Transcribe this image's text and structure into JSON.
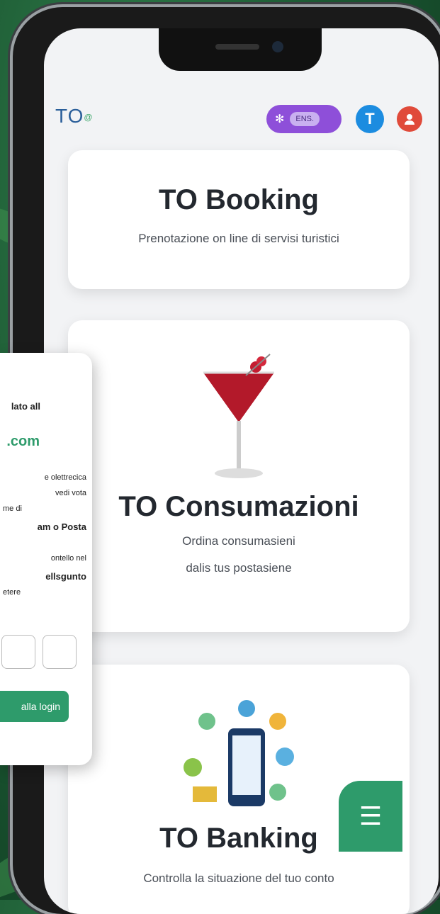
{
  "header": {
    "logo_text": "TO",
    "logo_suffix": "@",
    "pill_label": "ENS.",
    "pill_icon": "gear-sparkle-icon",
    "avatar_initial": "T",
    "user_icon": "user-icon"
  },
  "cards": [
    {
      "title": "TO Booking",
      "desc": "Prenotazione on line di servisi turistici"
    },
    {
      "title": "TO Consumazioni",
      "desc_line1": "Ordina consumasieni",
      "desc_line2": "dalis tus postasiene"
    },
    {
      "title": "TO Banking",
      "desc": "Controlla la situazione del tuo conto"
    }
  ],
  "modal": {
    "line1": "lato all",
    "email": ".com",
    "line2": "e olettrecica",
    "line3": "vedi vota",
    "line4": "me di",
    "line5": "am o Posta",
    "line6": "ontello nel",
    "line7": "ellsgunto",
    "line8": "etere",
    "login_label": "alla login"
  },
  "fab_icon": "menu-icon",
  "colors": {
    "brand_green": "#2e9b6b",
    "pill_purple": "#8e4fd9",
    "avatar_blue": "#1c8ce0",
    "user_red": "#e04a3a"
  }
}
